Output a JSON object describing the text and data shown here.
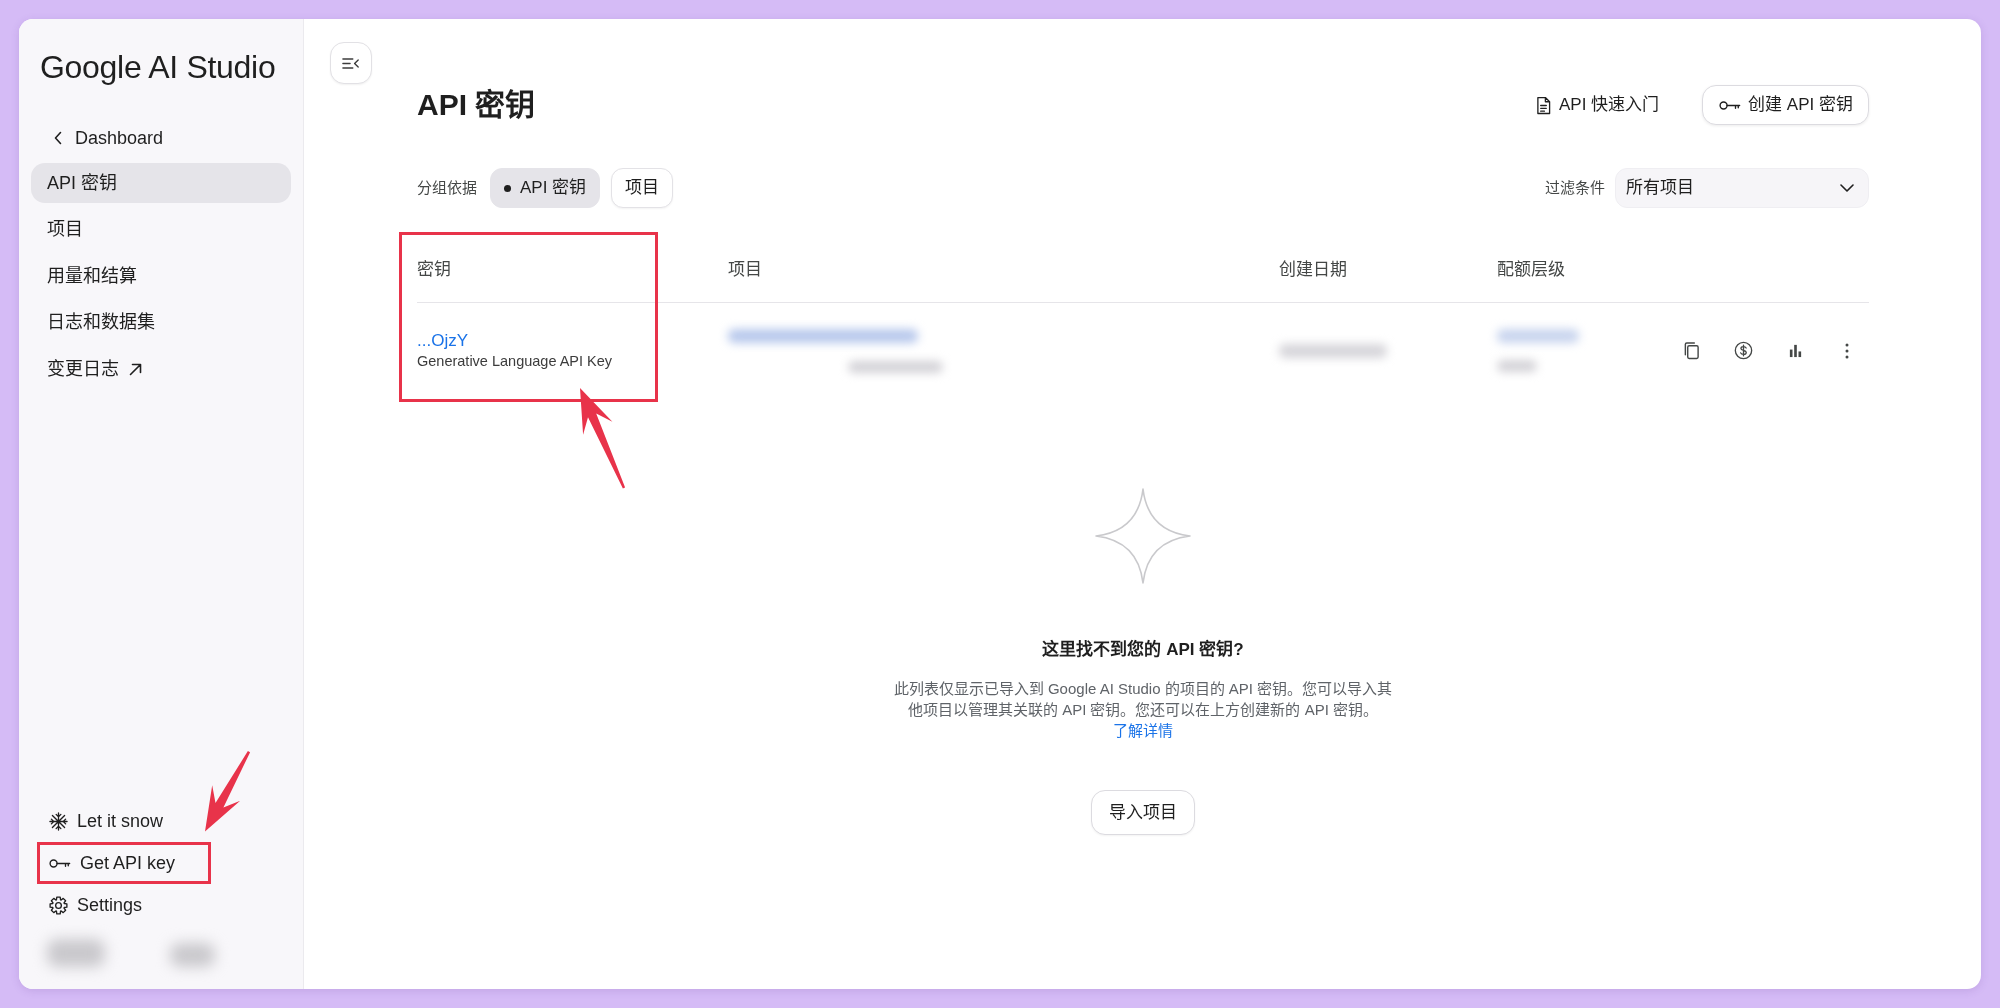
{
  "sidebar": {
    "logo": "Google AI Studio",
    "back_link": "Dashboard",
    "items": [
      {
        "label": "API 密钥",
        "selected": true,
        "external": false
      },
      {
        "label": "项目",
        "selected": false,
        "external": false
      },
      {
        "label": "用量和结算",
        "selected": false,
        "external": false
      },
      {
        "label": "日志和数据集",
        "selected": false,
        "external": false
      },
      {
        "label": "变更日志",
        "selected": false,
        "external": true
      }
    ],
    "footer_items": [
      {
        "kind": "snow",
        "label": "Let it snow",
        "highlighted": false
      },
      {
        "kind": "key",
        "label": "Get API key",
        "highlighted": true
      },
      {
        "kind": "settings",
        "label": "Settings",
        "highlighted": false
      }
    ]
  },
  "header": {
    "title": "API 密钥",
    "quickstart_link": "API 快速入门",
    "create_button": "创建 API 密钥"
  },
  "toolbar": {
    "group_by": {
      "label": "分组依据",
      "options": [
        {
          "label": "API 密钥",
          "selected": true
        },
        {
          "label": "项目",
          "selected": false
        }
      ]
    },
    "filter": {
      "label": "过滤条件",
      "value": "所有项目"
    }
  },
  "table": {
    "columns": [
      "密钥",
      "项目",
      "创建日期",
      "配额层级"
    ],
    "key_column_highlighted": true,
    "rows": [
      {
        "key": "...OjzY",
        "name": "Generative Language API Key"
      }
    ]
  },
  "empty_state": {
    "title": "这里找不到您的 API 密钥?",
    "description": "此列表仅显示已导入到 Google AI Studio 的项目的 API 密钥。您可以导入其他项目以管理其关联的 API 密钥。您还可以在上方创建新的 API 密钥。",
    "link": "了解详情",
    "button": "导入项目"
  }
}
